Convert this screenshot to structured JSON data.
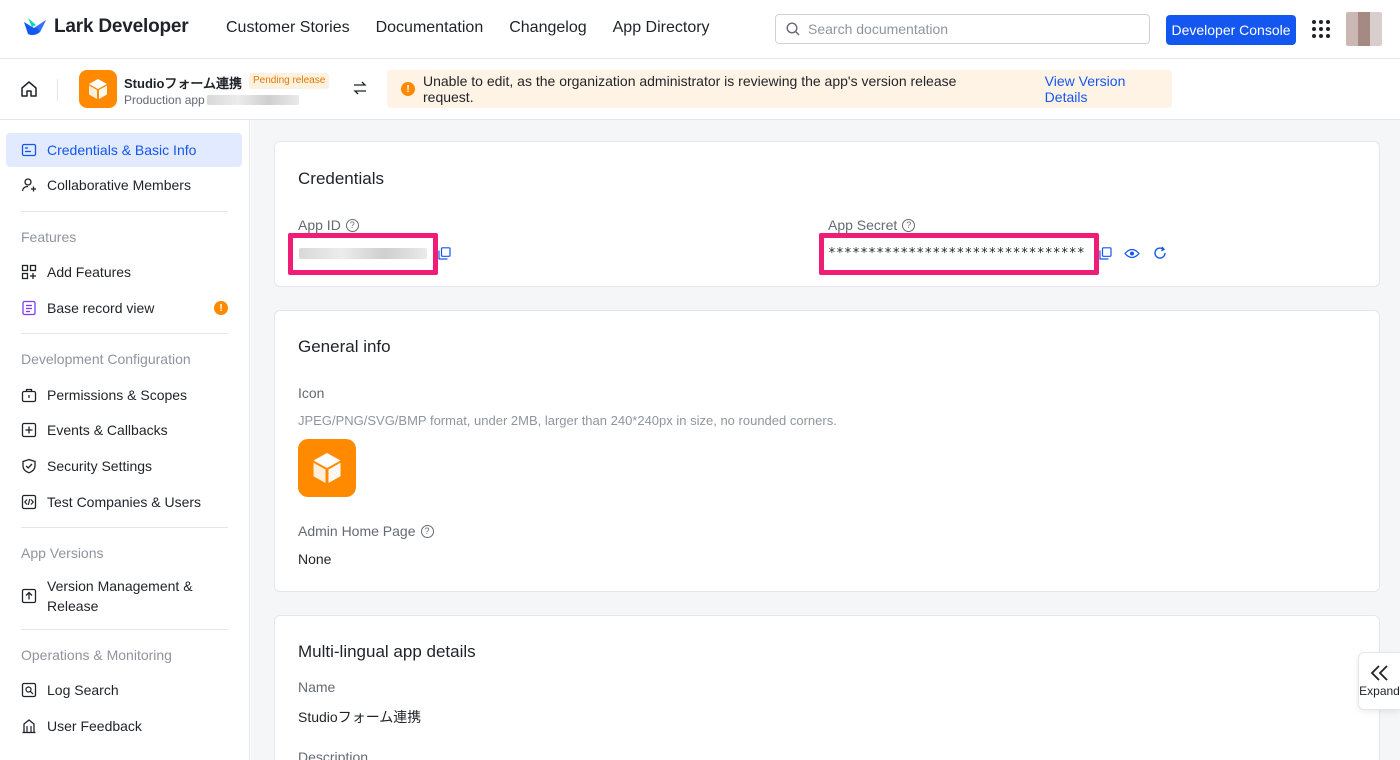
{
  "brand": {
    "name": "Lark Developer",
    "accent": "#1456f0"
  },
  "nav": {
    "links": [
      "Customer Stories",
      "Documentation",
      "Changelog",
      "App Directory"
    ],
    "search_placeholder": "Search documentation",
    "console_button": "Developer Console"
  },
  "app": {
    "name": "Studioフォーム連携",
    "status_badge": "Pending release",
    "subtitle": "Production app",
    "warning": "Unable to edit, as the organization administrator is reviewing the app's version release request.",
    "warning_link": "View Version Details",
    "icon_color": "#ff8a00"
  },
  "sidebar": {
    "items_top": [
      {
        "label": "Credentials & Basic Info",
        "icon": "credentials-icon",
        "active": true
      },
      {
        "label": "Collaborative Members",
        "icon": "member-add-icon"
      }
    ],
    "features_title": "Features",
    "features": [
      {
        "label": "Add Features",
        "icon": "add-features-icon"
      },
      {
        "label": "Base record view",
        "icon": "base-record-icon",
        "badge": "!"
      }
    ],
    "dev_title": "Development Configuration",
    "dev": [
      {
        "label": "Permissions & Scopes",
        "icon": "permissions-icon"
      },
      {
        "label": "Events & Callbacks",
        "icon": "events-icon"
      },
      {
        "label": "Security Settings",
        "icon": "shield-icon"
      },
      {
        "label": "Test Companies & Users",
        "icon": "code-icon"
      }
    ],
    "versions_title": "App Versions",
    "versions": [
      {
        "label": "Version Management & Release",
        "icon": "upload-icon"
      }
    ],
    "ops_title": "Operations & Monitoring",
    "ops": [
      {
        "label": "Log Search",
        "icon": "log-search-icon"
      },
      {
        "label": "User Feedback",
        "icon": "feedback-icon"
      }
    ]
  },
  "credentials": {
    "title": "Credentials",
    "app_id_label": "App ID",
    "app_secret_label": "App Secret",
    "app_secret_value": "********************************"
  },
  "general": {
    "title": "General info",
    "icon_label": "Icon",
    "icon_hint": "JPEG/PNG/SVG/BMP format, under 2MB, larger than 240*240px in size, no rounded corners.",
    "admin_label": "Admin Home Page",
    "admin_value": "None"
  },
  "multilingual": {
    "title": "Multi-lingual app details",
    "name_label": "Name",
    "name_value": "Studioフォーム連携",
    "description_label": "Description"
  },
  "expand": {
    "label": "Expand"
  },
  "highlight_color": "#f01d76"
}
